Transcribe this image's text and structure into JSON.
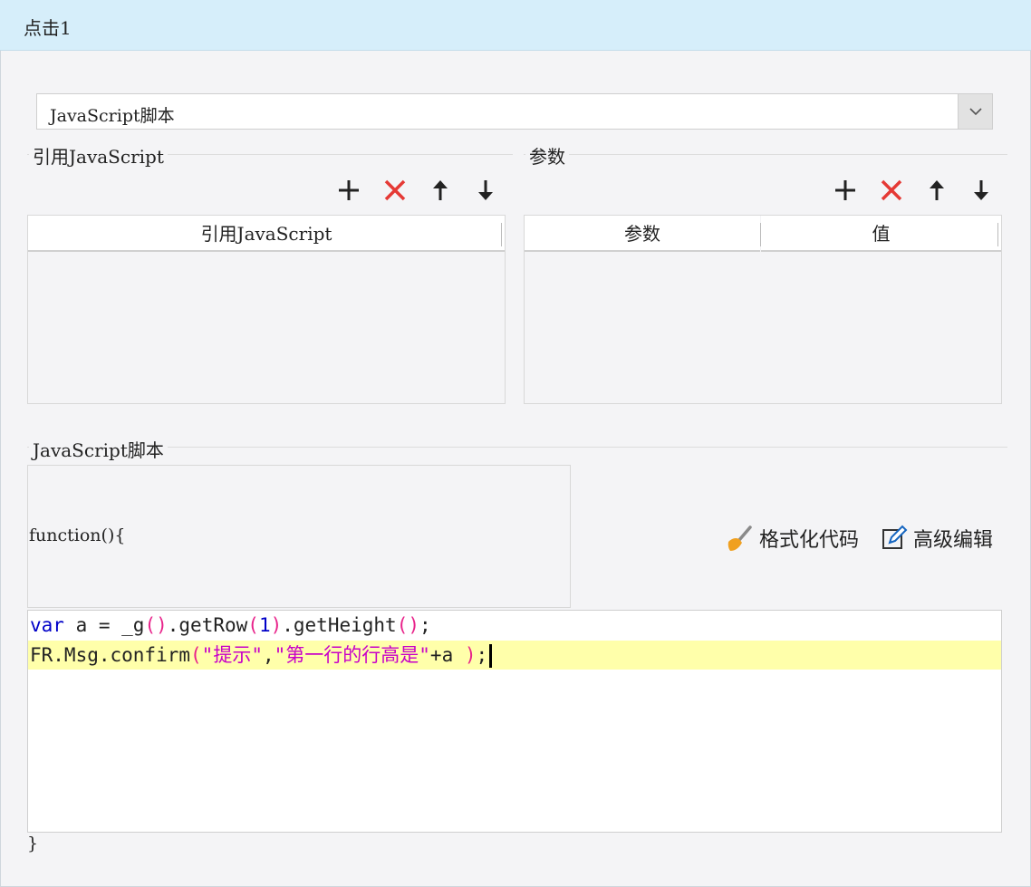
{
  "header": {
    "title": "点击1"
  },
  "type_select": {
    "value": "JavaScript脚本"
  },
  "refs_section": {
    "title": "引用JavaScript",
    "column": "引用JavaScript",
    "rows": []
  },
  "params_section": {
    "title": "参数",
    "columns": [
      "参数",
      "值"
    ],
    "rows": []
  },
  "script_section": {
    "title": "JavaScript脚本",
    "function_header": "function(){",
    "function_footer": "}",
    "format_label": "格式化代码",
    "advanced_label": "高级编辑",
    "code_lines": [
      "var a = _g().getRow(1).getHeight();",
      "FR.Msg.confirm(\"提示\",\"第一行的行高是\"+a );"
    ]
  },
  "colors": {
    "header_bg": "#d6eefa",
    "current_line": "#ffffaa",
    "delete_red": "#e53935",
    "keyword": "#0000c8",
    "string": "#c800c8"
  }
}
